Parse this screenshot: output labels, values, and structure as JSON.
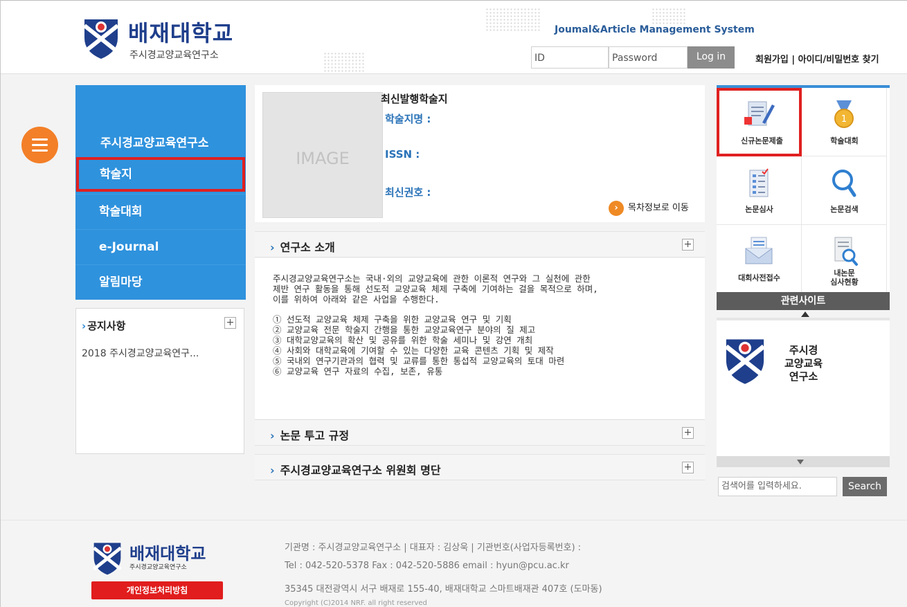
{
  "header": {
    "logo_name": "배재대학교",
    "logo_sub": "주시경교양교육연구소",
    "system_title": "Joumal&Article Management System",
    "id_placeholder": "ID",
    "password_placeholder": "Password",
    "login_label": "Log in",
    "links": "회원가입 | 아이디/비밀번호 찾기"
  },
  "left_nav": {
    "title": "주시경교양교육연구소",
    "items": [
      {
        "label": "학술지"
      },
      {
        "label": "학술대회"
      },
      {
        "label": "e-Journal"
      },
      {
        "label": "알림마당"
      }
    ]
  },
  "notice": {
    "title": "공지사항",
    "plus": "+",
    "items": [
      "2018 주시경교양교육연구..."
    ]
  },
  "latest": {
    "image_placeholder": "IMAGE",
    "title": "최신발행학술지",
    "journal_name_label": "학술지명 :",
    "issn_label": "ISSN :",
    "latest_issue_label": "최신권호 :",
    "toc_link": "목차정보로 이동",
    "toc_icon": "›"
  },
  "sections": {
    "intro_title": "연구소 소개",
    "submission_title": "논문 투고 규정",
    "committee_title": "주시경교양교육연구소 위원회 명단",
    "arrow": "›",
    "plus": "+"
  },
  "intro": {
    "paragraph": "주시경교양교육연구소는 국내·외의 교양교육에 관한 이론적 연구와 그 실천에 관한\n제반 연구 활동을 통해 선도적 교양교육 체제 구축에 기여하는 걸을 목적으로 하며,\n이를 위하여 아래와 같은 사업을 수행한다.",
    "items": [
      "① 선도적 교양교육 체제 구축을 위한 교양교육 연구 및 기획",
      "② 교양교육 전문 학술지 간행을 통한 교양교육연구 분야의 질 제고",
      "③ 대학교양교육의 확산 및 공유를 위한 학술 세미나 및 강연 개최",
      "④ 사회와 대학교육에 기여할 수 있는 다양한 교육 콘텐츠 기획 및 제작",
      "⑤ 국내외 연구기관과의 협력 및 교류를 통한 통섭적 교양교육의 토대 마련",
      "⑥ 교양교육 연구 자료의 수집, 보존, 유통"
    ]
  },
  "quick_menu": [
    {
      "label": "신규논문제출",
      "icon": "document-pen-icon"
    },
    {
      "label": "학술대회",
      "icon": "medal-icon"
    },
    {
      "label": "논문심사",
      "icon": "checklist-icon"
    },
    {
      "label": "논문검색",
      "icon": "magnifier-icon"
    },
    {
      "label": "대회사전접수",
      "icon": "envelope-icon"
    },
    {
      "label": "내논문\n심사현황",
      "icon": "document-search-icon"
    }
  ],
  "related": {
    "bar_label": "관련사이트",
    "site_text": "주시경\n교양교육\n연구소"
  },
  "search": {
    "placeholder": "검색어를 입력하세요.",
    "button": "Search"
  },
  "footer": {
    "logo_name": "배재대학교",
    "logo_sub": "주시경교양교육연구소",
    "privacy": "개인정보처리방침",
    "line1": "기관명 : 주시경교양교육연구소 | 대표자 : 김상욱 | 기관번호(사업자등록번호) :",
    "line2": "Tel : 042-520-5378 Fax : 042-520-5886 email : hyun@pcu.ac.kr",
    "line3": "35345 대전광역시 서구 배재로 155-40, 배재대학교 스마트배재관 407호 (도마동)",
    "copyright": "Copyright (C)2014 NRF. all right reserved"
  },
  "colors": {
    "brand_blue": "#1f3f8c",
    "nav_blue": "#2f92dd",
    "highlight_red": "#e02020",
    "accent_orange": "#f37f28"
  }
}
